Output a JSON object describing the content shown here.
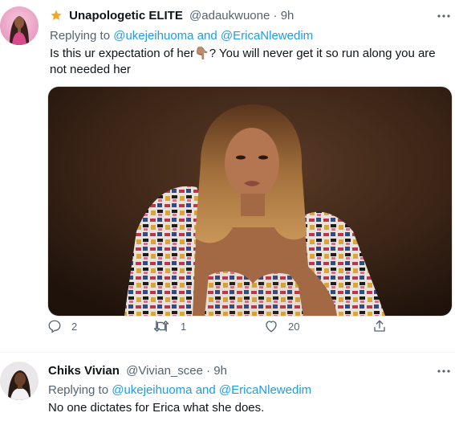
{
  "tweets": [
    {
      "name": "Unapologetic ELITE",
      "handle": "@adaukwuone",
      "separator": "·",
      "time": "9h",
      "replying_prefix": "Replying to",
      "mention_1": "@ukejeihuoma",
      "conjunction": "and",
      "mention_2": "@EricaNlewedim",
      "text_line_1": "Is this ur expectation of her",
      "emoji": "👇🏽",
      "text_line_1_cont": "? You will never get it so run along you are",
      "text_line_2": "not needed her",
      "replies": "2",
      "retweets": "1",
      "likes": "20"
    },
    {
      "name": "Chiks Vivian",
      "handle": "@Vivian_scee",
      "separator": "·",
      "time": "9h",
      "replying_prefix": "Replying to",
      "mention_1": "@ukejeihuoma",
      "conjunction": "and",
      "mention_2": "@EricaNlewedim",
      "text_line_1": "No one dictates for Erica what she does."
    }
  ],
  "colors": {
    "accent": "#1d9bf0",
    "secondary_text": "#536471",
    "badge": "#f5a623"
  }
}
